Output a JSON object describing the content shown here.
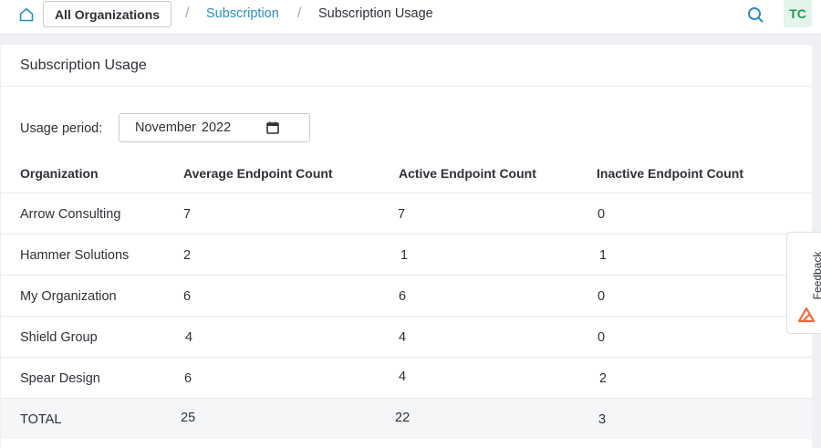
{
  "header": {
    "org_button": "All Organizations",
    "breadcrumb": {
      "link": "Subscription",
      "current": "Subscription Usage"
    },
    "avatar_initials": "TC",
    "icons": [
      "home-icon",
      "search-icon"
    ]
  },
  "card": {
    "title": "Subscription Usage",
    "usage_period": {
      "label": "Usage period:",
      "value": "November 2022"
    }
  },
  "table": {
    "columns": [
      "Organization",
      "Average Endpoint Count",
      "Active Endpoint Count",
      "Inactive Endpoint Count"
    ],
    "rows": [
      {
        "organization": "Arrow Consulting",
        "average": "7",
        "active": "7",
        "inactive": "0"
      },
      {
        "organization": "Hammer Solutions",
        "average": "2",
        "active": "1",
        "inactive": "1"
      },
      {
        "organization": "My Organization",
        "average": "6",
        "active": "6",
        "inactive": "0"
      },
      {
        "organization": "Shield Group",
        "average": "4",
        "active": "4",
        "inactive": "0"
      },
      {
        "organization": "Spear Design",
        "average": "6",
        "active": "4",
        "inactive": "2"
      }
    ],
    "total": {
      "organization": "TOTAL",
      "average": "25",
      "active": "22",
      "inactive": "3"
    }
  },
  "feedback": {
    "label": "Feedback"
  },
  "colors": {
    "accent": "#2a90c0",
    "avatar_bg": "#e3f4ea",
    "avatar_fg": "#1f9a55",
    "feedback_logo": "#f26b3a"
  }
}
